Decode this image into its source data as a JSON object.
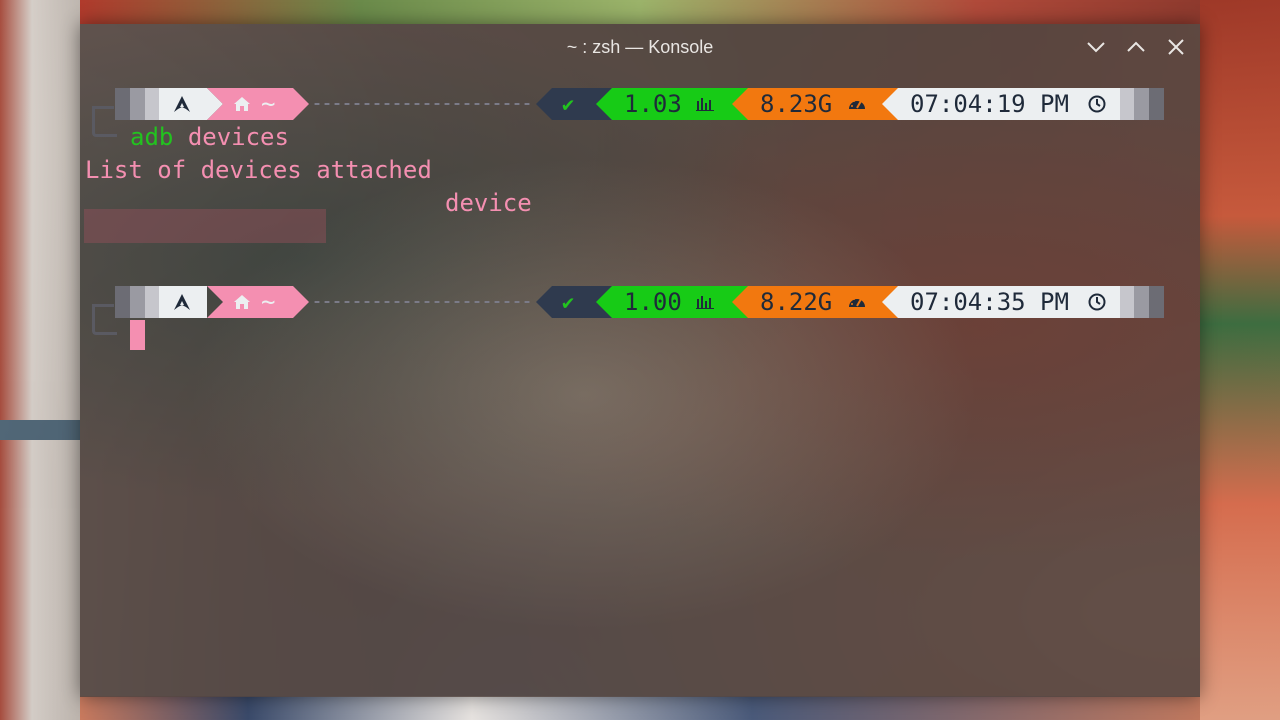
{
  "window": {
    "title": "~ : zsh — Konsole",
    "controls": [
      "minimize-icon",
      "maximize-icon",
      "close-icon"
    ]
  },
  "colors": {
    "pink": "#f48fb1",
    "green_cmd": "#22c31f",
    "status_ok_bg": "#2f3a4e",
    "load_bg": "#17cb16",
    "mem_bg": "#f2780f",
    "time_bg": "#eceff1",
    "segment_text": "#1f2a3a"
  },
  "prompts": [
    {
      "os_icon": "arch-linux-icon",
      "dir_icon": "home-icon",
      "dir": "~",
      "status": "✔",
      "load": "1.03",
      "load_icon": "bar-chart-icon",
      "mem": "8.23G",
      "mem_icon": "gauge-icon",
      "time": "07:04:19 PM",
      "time_icon": "clock-icon"
    },
    {
      "os_icon": "arch-linux-icon",
      "dir_icon": "home-icon",
      "dir": "~",
      "status": "✔",
      "load": "1.00",
      "load_icon": "bar-chart-icon",
      "mem": "8.22G",
      "mem_icon": "gauge-icon",
      "time": "07:04:35 PM",
      "time_icon": "clock-icon"
    }
  ],
  "command": {
    "name": "adb",
    "args": "devices"
  },
  "output": {
    "line1": "List of devices attached",
    "line2_state": "device"
  }
}
